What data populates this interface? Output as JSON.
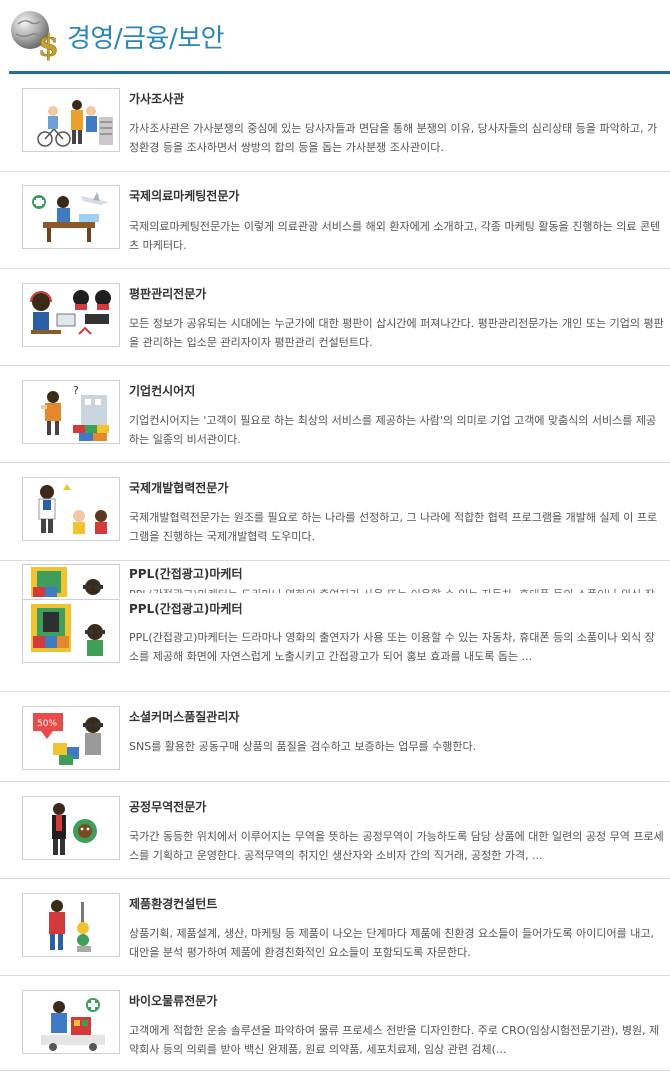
{
  "header": {
    "title": "경영/금융/보안",
    "icon": "globe-dollar-icon"
  },
  "items": [
    {
      "title": "가사조사관",
      "desc": "가사조사관은 가사분쟁의 중심에 있는 당사자들과 면담을 통해 분쟁의 이유, 당사자들의 심리상태 등을 파악하고, 가정환경 등을 조사하면서 쌍방의 합의 등을 돕는 가사분쟁 조사관이다.",
      "icon": "family-bicycle-illustration"
    },
    {
      "title": "국제의료마케팅전문가",
      "desc": "국제의료마케팅전문가는 이렇게 의료관광 서비스를 해외 환자에게 소개하고, 각종 마케팅 활동을 진행하는 의료 콘텐츠 마케터다.",
      "icon": "medical-marketing-illustration"
    },
    {
      "title": "평판관리전문가",
      "desc": "모든 정보가 공유되는 시대에는 누군가에 대한 평판이 삽시간에 퍼져나간다. 평판관리전문가는 개인 또는 기업의 평판을 관리하는 입소문 관리자이자 평판관리 컨설턴트다.",
      "icon": "reputation-illustration"
    },
    {
      "title": "기업컨시어지",
      "desc": "기업컨시어지는 '고객이 필요로 하는 최상의 서비스를 제공하는 사람'의 의미로 기업 고객에 맞춤식의 서비스를 제공하는 일종의 비서관이다.",
      "icon": "concierge-illustration"
    },
    {
      "title": "국제개발협력전문가",
      "desc": "국제개발협력전문가는 원조를 필요로 하는 나라를 선정하고, 그 나라에 적합한 협력 프로그램을 개발해 실제 이 프로그램을 진행하는 국제개발협력 도우미다.",
      "icon": "development-cooperation-illustration"
    },
    {
      "title": "PPL(간접광고)마케터",
      "desc": "PPL(간접광고)마케터는 드라마나 영화의 출연자가 사용 또는 이용할 수 있는 자동차, 휴대폰 등의 소품이나 외식 장소를 제공해 화면에 자연스럽게 노출시키고 간접광고가 되어 홍보 효과를 내도록 돕는 ...",
      "icon": "ppl-marketer-illustration"
    },
    {
      "title": "소셜커머스품질관리자",
      "desc": "SNS를 활용한 공동구매 상품의 품질을 검수하고 보증하는 업무를 수행한다.",
      "icon": "social-commerce-illustration"
    },
    {
      "title": "공정무역전문가",
      "desc": "국가간 동등한 위치에서 이루어지는 무역을 뜻하는 공정무역이 가능하도록 담당 상품에 대한 일련의 공정 무역 프로세스를 기획하고 운영한다. 공적무역의 취지인 생산자와 소비자 간의 직거래, 공정한 가격, ...",
      "icon": "fair-trade-illustration"
    },
    {
      "title": "제품환경컨설턴트",
      "desc": "상품기획, 제품설계, 생산, 마케팅 등 제품이 나오는 단계마다 제품에 친환경 요소들이 들어가도록 아이디어를 내고, 대안을 분석 평가하여 제품에 환경친화적인 요소들이 포함되도록 자문한다.",
      "icon": "eco-consultant-illustration"
    },
    {
      "title": "바이오물류전문가",
      "desc": "고객에게 적합한 운송 솔루션을 파악하여 물류 프로세스 전반을 디자인한다. 주로 CRO(임상시험전문기관), 병원, 제약회사 등의 의뢰를 받아 백신 완제품, 원료 의약품, 세포치료제, 임상 관련 검체(...",
      "icon": "bio-logistics-illustration"
    }
  ]
}
